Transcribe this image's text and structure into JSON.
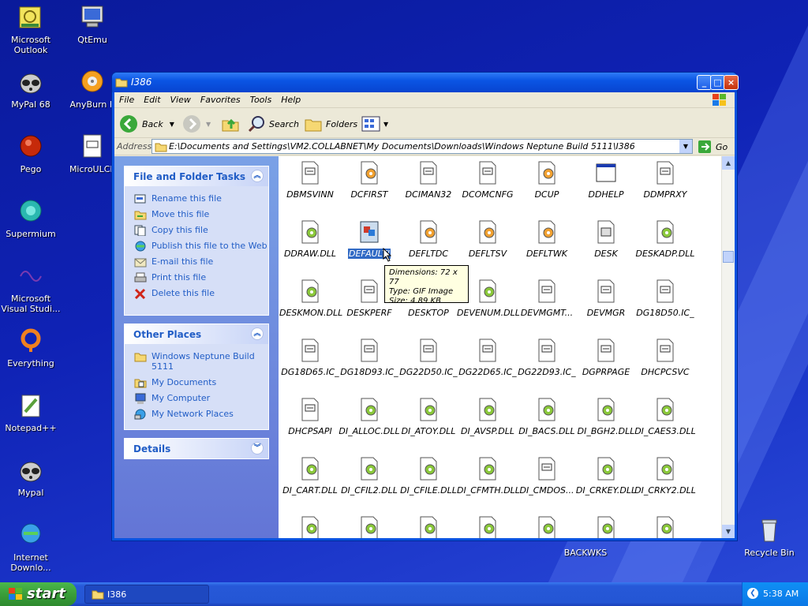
{
  "desktop": {
    "icons": [
      {
        "label": "Microsoft Outlook",
        "icon": "outlook-icon"
      },
      {
        "label": "QtEmu",
        "icon": "qtemu-icon"
      },
      {
        "label": "MyPal 68",
        "icon": "mypal-icon"
      },
      {
        "label": "AnyBurn P",
        "icon": "anyburn-icon"
      },
      {
        "label": "Pego",
        "icon": "pego-icon"
      },
      {
        "label": "MicroULCP",
        "icon": "file-icon"
      },
      {
        "label": "Supermium",
        "icon": "supermium-icon"
      },
      {
        "label": "Microsoft Visual Studi...",
        "icon": "visual-studio-icon"
      },
      {
        "label": "Everything",
        "icon": "everything-icon"
      },
      {
        "label": "Notepad++",
        "icon": "notepad-icon"
      },
      {
        "label": "Mypal",
        "icon": "mypal-icon"
      },
      {
        "label": "Internet Downlo...",
        "icon": "internet-download-icon"
      },
      {
        "label": "BACKWKS",
        "icon": "folder-icon"
      },
      {
        "label": "Recycle Bin",
        "icon": "recycle-bin-icon"
      }
    ]
  },
  "window": {
    "title": "I386",
    "menu": [
      "File",
      "Edit",
      "View",
      "Favorites",
      "Tools",
      "Help"
    ],
    "toolbar": {
      "back": "Back",
      "search": "Search",
      "folders": "Folders"
    },
    "address": {
      "label": "Address",
      "value": "E:\\Documents and Settings\\VM2.COLLABNET\\My Documents\\Downloads\\Windows Neptune Build 5111\\I386",
      "go": "Go"
    },
    "tasks": {
      "title": "File and Folder Tasks",
      "items": [
        "Rename this file",
        "Move this file",
        "Copy this file",
        "Publish this file to the Web",
        "E-mail this file",
        "Print this file",
        "Delete this file"
      ]
    },
    "places": {
      "title": "Other Places",
      "items": [
        "Windows Neptune Build 5111",
        "My Documents",
        "My Computer",
        "My Network Places"
      ]
    },
    "details": {
      "title": "Details"
    },
    "files": [
      [
        "DBMSVINN",
        "DCFIRST",
        "DCIMAN32",
        "DCOMCNFG",
        "DCUP",
        "DDHELP",
        "DDMPRXY"
      ],
      [
        "DDRAW.DLL",
        "DEFAULTI",
        "DEFLTDC",
        "DEFLTSV",
        "DEFLTWK",
        "DESK",
        "DESKADP.DLL"
      ],
      [
        "DESKMON.DLL",
        "DESKPERF",
        "DESKTOP",
        "DEVENUM.DLL",
        "DEVMGMT...",
        "DEVMGR",
        "DG18D50.IC_"
      ],
      [
        "DG18D65.IC_",
        "DG18D93.IC_",
        "DG22D50.IC_",
        "DG22D65.IC_",
        "DG22D93.IC_",
        "DGPRPAGE",
        "DHCPCSVC"
      ],
      [
        "DHCPSAPI",
        "DI_ALLOC.DLL",
        "DI_ATOY.DLL",
        "DI_AVSP.DLL",
        "DI_BACS.DLL",
        "DI_BGH2.DLL",
        "DI_CAES3.DLL"
      ],
      [
        "DI_CART.DLL",
        "DI_CFIL2.DLL",
        "DI_CFILE.DLL",
        "DI_CFMTH.DLL",
        "DI_CMDOS...",
        "DI_CRKEY.DLL",
        "DI_CRKY2.DLL"
      ]
    ],
    "tooltip": {
      "dimensions": "Dimensions: 72 x 77",
      "type": "Type: GIF Image",
      "size": "Size: 4.89 KB"
    }
  },
  "taskbar": {
    "start": "start",
    "window": "I386",
    "clock": "5:38 AM"
  }
}
